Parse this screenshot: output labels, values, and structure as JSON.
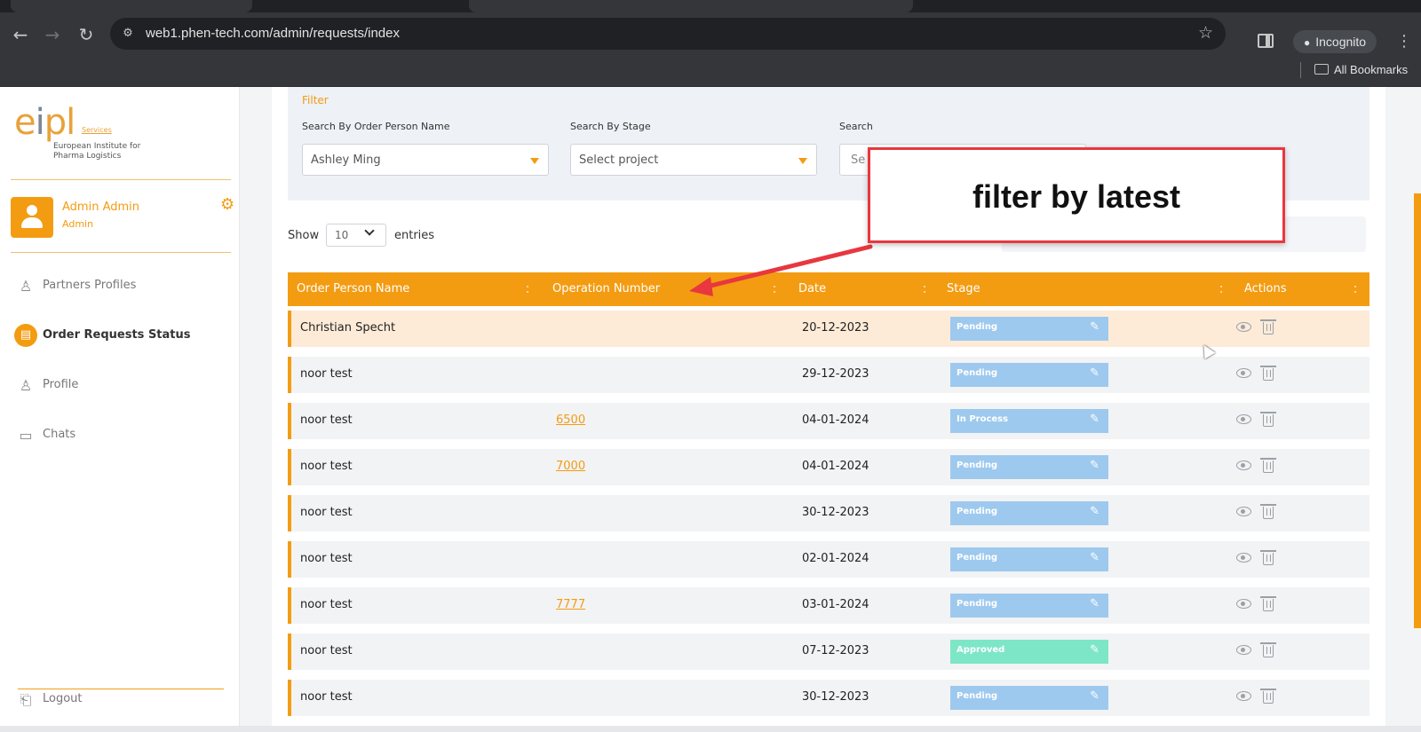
{
  "browser": {
    "url": "web1.phen-tech.com/admin/requests/index",
    "profile_label": "Incognito",
    "bookmarks_label": "All Bookmarks"
  },
  "sidebar": {
    "logo": {
      "mark_left": "e",
      "mark_mid": "i",
      "mark_right": "pl",
      "services": "Services",
      "line1": "European Institute for",
      "line2": "Pharma Logistics"
    },
    "user": {
      "name": "Admin Admin",
      "role": "Admin"
    },
    "items": [
      {
        "label": "Partners Profiles",
        "icon": "user-icon",
        "active": false
      },
      {
        "label": "Order Requests Status",
        "icon": "request-icon",
        "active": true
      },
      {
        "label": "Profile",
        "icon": "user-icon",
        "active": false
      },
      {
        "label": "Chats",
        "icon": "chat-icon",
        "active": false
      }
    ],
    "logout_label": "Logout"
  },
  "filter": {
    "title": "Filter",
    "order_person_label": "Search By Order Person Name",
    "order_person_value": "Ashley Ming",
    "stage_label": "Search By Stage",
    "stage_value": "Select project",
    "search_label": "Search",
    "search_placeholder": "Se"
  },
  "table": {
    "show_label": "Show",
    "entries_value": "10",
    "entries_label": "entries",
    "headers": [
      "Order Person Name",
      "Operation Number",
      "Date",
      "Stage",
      "Actions"
    ],
    "rows": [
      {
        "name": "Christian Specht",
        "operation": "",
        "date": "20-12-2023",
        "stage": "Pending"
      },
      {
        "name": "noor test",
        "operation": "",
        "date": "29-12-2023",
        "stage": "Pending"
      },
      {
        "name": "noor test",
        "operation": "6500",
        "date": "04-01-2024",
        "stage": "In Process"
      },
      {
        "name": "noor test",
        "operation": "7000",
        "date": "04-01-2024",
        "stage": "Pending"
      },
      {
        "name": "noor test",
        "operation": "",
        "date": "30-12-2023",
        "stage": "Pending"
      },
      {
        "name": "noor test",
        "operation": "",
        "date": "02-01-2024",
        "stage": "Pending"
      },
      {
        "name": "noor test",
        "operation": "7777",
        "date": "03-01-2024",
        "stage": "Pending"
      },
      {
        "name": "noor test",
        "operation": "",
        "date": "07-12-2023",
        "stage": "Approved"
      },
      {
        "name": "noor test",
        "operation": "",
        "date": "30-12-2023",
        "stage": "Pending"
      }
    ]
  },
  "annotation": {
    "text": "filter by latest"
  },
  "colors": {
    "accent": "#f39c12",
    "pending": "#9ec9ee",
    "approved": "#7de6c6",
    "highlight_row": "#fdebd8",
    "annotation_border": "#e8373e"
  }
}
